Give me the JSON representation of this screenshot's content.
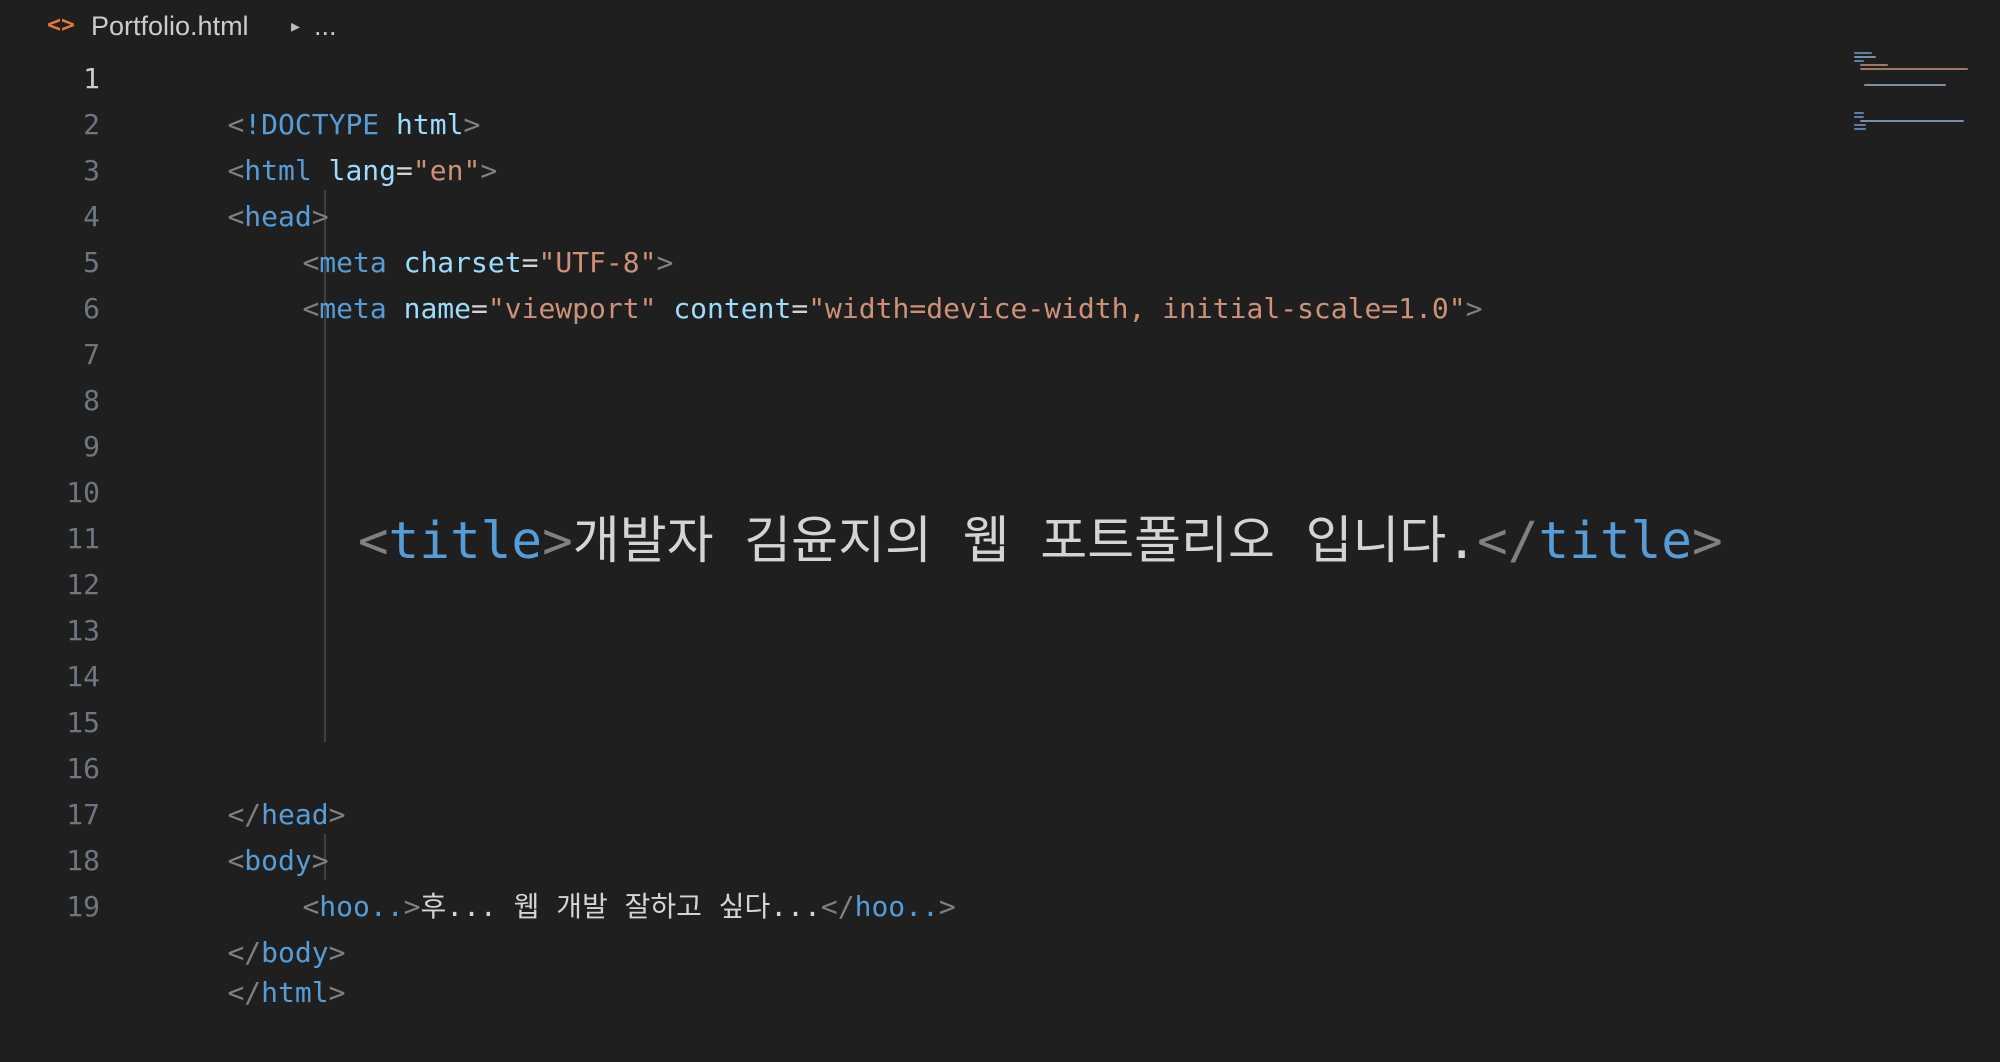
{
  "breadcrumb": {
    "file_icon": "html-file-icon",
    "file": "Portfolio.html",
    "chevron": "▸",
    "ellipsis": "..."
  },
  "editor": {
    "active_line": 1,
    "line_numbers": [
      "1",
      "2",
      "3",
      "4",
      "5",
      "6",
      "7",
      "8",
      "9",
      "10",
      "11",
      "12",
      "13",
      "14",
      "15",
      "16",
      "17",
      "18",
      "19"
    ],
    "lines": {
      "l1": {
        "open": "<",
        "bang": "!DOCTYPE",
        "sp": " ",
        "attr": "html",
        "close": ">"
      },
      "l2": {
        "open": "<",
        "tag": "html",
        "sp": " ",
        "attr": "lang",
        "eq": "=",
        "val": "\"en\"",
        "close": ">"
      },
      "l3": {
        "open": "<",
        "tag": "head",
        "close": ">"
      },
      "l4": {
        "open": "<",
        "tag": "meta",
        "sp": " ",
        "attr": "charset",
        "eq": "=",
        "val": "\"UTF-8\"",
        "close": ">"
      },
      "l5": {
        "open": "<",
        "tag": "meta",
        "sp1": " ",
        "attr1": "name",
        "eq1": "=",
        "val1": "\"viewport\"",
        "sp2": " ",
        "attr2": "content",
        "eq2": "=",
        "val2": "\"width=device-width, initial-scale=1.0\"",
        "close": ">"
      },
      "l9": {
        "open": "<",
        "tag": "title",
        "close": ">",
        "text": "개발자 김윤지의 웹 포트폴리오 입니다.",
        "end_open": "</",
        "end_tag": "title",
        "end_close": ">"
      },
      "l15": {
        "open": "</",
        "tag": "head",
        "close": ">"
      },
      "l16": {
        "open": "<",
        "tag": "body",
        "close": ">"
      },
      "l17": {
        "open": "<",
        "tag": "hoo..",
        "close": ">",
        "text": "후... 웹 개발 잘하고 싶다...",
        "end_open": "</",
        "end_tag": "hoo..",
        "end_close": ">"
      },
      "l18": {
        "open": "</",
        "tag": "body",
        "close": ">"
      },
      "l19": {
        "open": "</",
        "tag": "html",
        "close": ">"
      }
    }
  },
  "colors": {
    "background": "#1f1f1f",
    "tag": "#569cd6",
    "attribute": "#9cdcfe",
    "string": "#ce9178",
    "bracket": "#808080",
    "text": "#d4d4d4",
    "line_number": "#6e7681",
    "file_icon": "#e37933"
  }
}
